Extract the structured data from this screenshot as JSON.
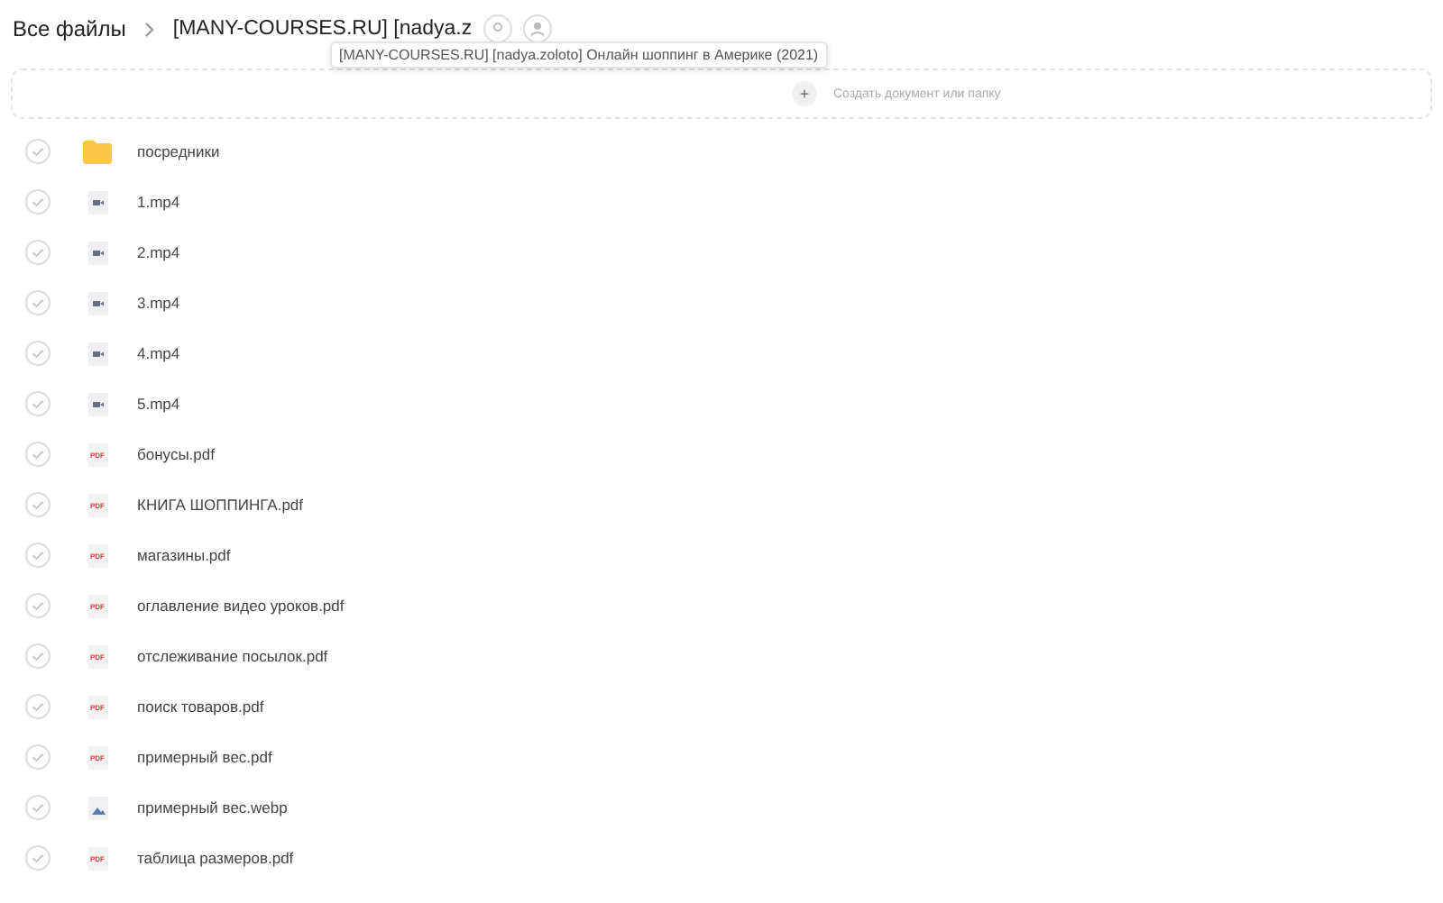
{
  "breadcrumbs": [
    {
      "label": "Все файлы"
    },
    {
      "label": "[MANY-COURSES.RU] [nadya.z"
    }
  ],
  "tooltip": "[MANY-COURSES.RU] [nadya.zoloto] Онлайн шоппинг в Америке (2021)",
  "create_bar": {
    "plus": "+",
    "label": "Создать документ или папку"
  },
  "items": [
    {
      "kind": "folder",
      "name": "посредники",
      "checked": false
    },
    {
      "kind": "video",
      "name": "1.mp4",
      "checked": false
    },
    {
      "kind": "video",
      "name": "2.mp4",
      "checked": false
    },
    {
      "kind": "video",
      "name": "3.mp4",
      "checked": false
    },
    {
      "kind": "video",
      "name": "4.mp4",
      "checked": false
    },
    {
      "kind": "video",
      "name": "5.mp4",
      "checked": false
    },
    {
      "kind": "pdf",
      "badge": "PDF",
      "name": "бонусы.pdf",
      "checked": false
    },
    {
      "kind": "pdf",
      "badge": "PDF",
      "name": "КНИГА ШОППИНГА.pdf",
      "checked": false
    },
    {
      "kind": "pdf",
      "badge": "PDF",
      "name": "магазины.pdf",
      "checked": false
    },
    {
      "kind": "pdf",
      "badge": "PDF",
      "name": "оглавление видео уроков.pdf",
      "checked": false
    },
    {
      "kind": "pdf",
      "badge": "PDF",
      "name": "отслеживание посылок.pdf",
      "checked": false
    },
    {
      "kind": "pdf",
      "badge": "PDF",
      "name": "поиск товаров.pdf",
      "checked": false
    },
    {
      "kind": "pdf",
      "badge": "PDF",
      "name": "примерный вес.pdf",
      "checked": false
    },
    {
      "kind": "image",
      "name": "примерный вес.webp",
      "checked": false
    },
    {
      "kind": "pdf",
      "badge": "PDF",
      "name": "таблица размеров.pdf",
      "checked": false
    }
  ]
}
